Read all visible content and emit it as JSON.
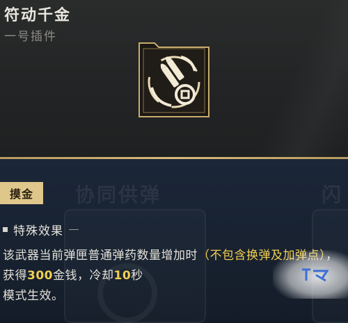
{
  "item": {
    "name": "符动千金",
    "slot": "一号插件",
    "icon": "bullets-coin-icon"
  },
  "background": {
    "ghost_label_1": "协同供弹",
    "ghost_label_2": "闪"
  },
  "tag": {
    "label": "摸金"
  },
  "effect": {
    "heading": "特殊效果",
    "segments": {
      "a": "该武器当前弹匣普通弹药数量增加时",
      "b": "（不包含换弹及加弹点）",
      "c": "，获得",
      "d": "300",
      "e": "金钱，冷却",
      "f": "10",
      "g": "秒",
      "h": "模式生效。"
    }
  },
  "colors": {
    "gold_accent": "#dfc78c",
    "highlight_yellow": "#f2cf52",
    "panel_navy": "#1b2638"
  }
}
